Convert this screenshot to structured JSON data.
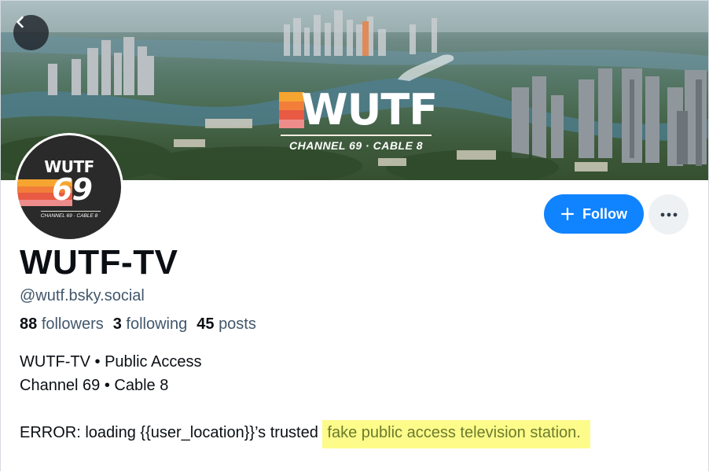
{
  "banner": {
    "logo_text": "WUTF",
    "logo_subtitle": "CHANNEL 69 · CABLE 8",
    "stripe_colors": [
      "#f6a531",
      "#f27e3a",
      "#e85a43",
      "#ee8c8c"
    ]
  },
  "avatar": {
    "top_text": "WUTF",
    "number": "69",
    "subtitle": "CHANNEL 69 · CABLE 8"
  },
  "actions": {
    "follow_label": "Follow",
    "follow_icon": "plus-icon",
    "more_icon": "ellipsis-icon",
    "back_icon": "chevron-left-icon"
  },
  "profile": {
    "display_name": "WUTF-TV",
    "handle": "@wutf.bsky.social",
    "stats": {
      "followers_count": "88",
      "followers_label": "followers",
      "following_count": "3",
      "following_label": "following",
      "posts_count": "45",
      "posts_label": "posts"
    },
    "bio": {
      "line1": "WUTF-TV • Public Access",
      "line2": "Channel 69 • Cable 8",
      "line3_plain": "ERROR: loading {{user_location}}’s trusted ",
      "line3_highlight": "fake public access television station."
    }
  },
  "colors": {
    "accent": "#1083fe",
    "highlight": "#fdfb8a",
    "muted_text": "#42576c"
  }
}
